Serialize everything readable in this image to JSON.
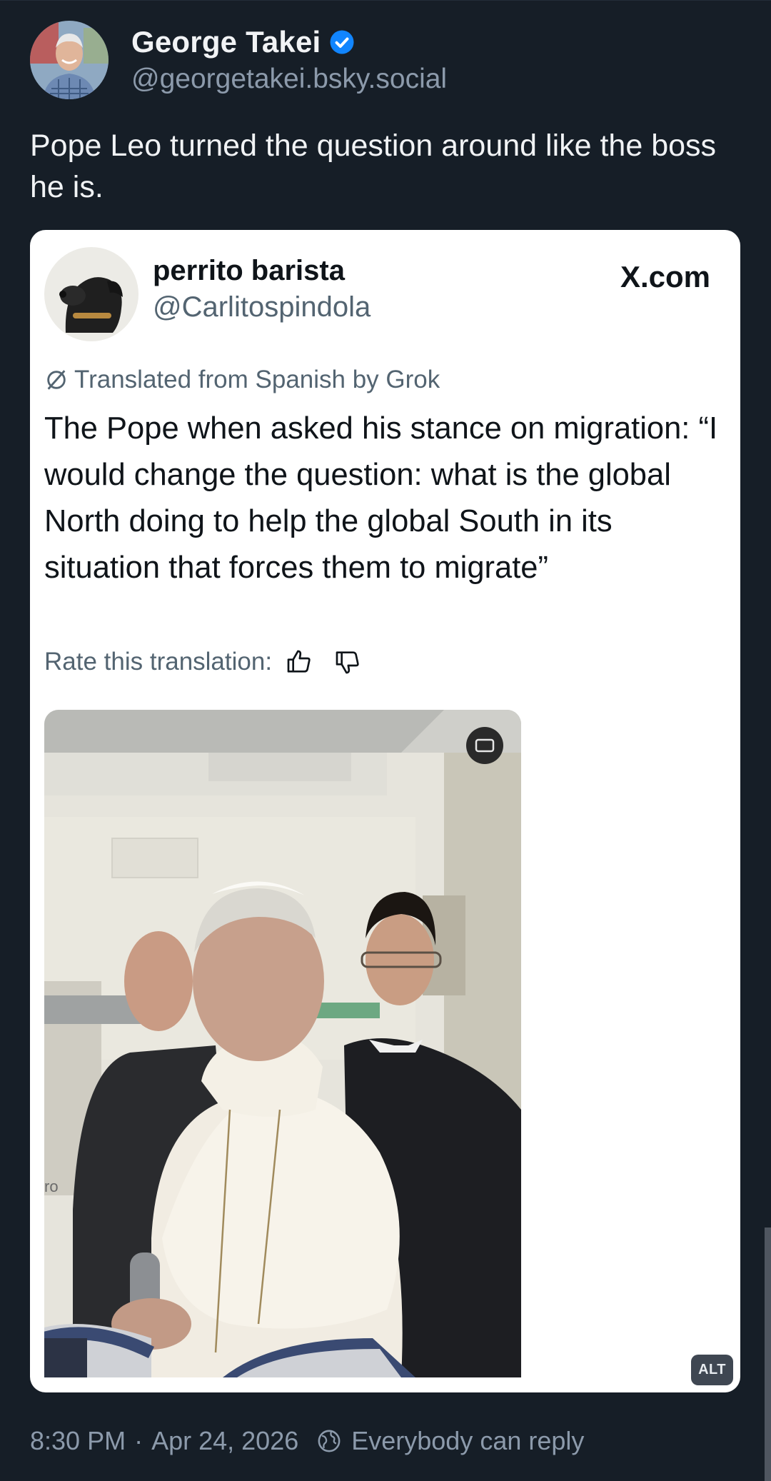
{
  "post": {
    "author": {
      "display_name": "George Takei",
      "handle": "@georgetakei.bsky.social",
      "verified_icon": "verified-check-icon"
    },
    "text": "Pope Leo turned the question around like the boss he is.",
    "footer": {
      "time": "8:30 PM",
      "separator": "·",
      "date": "Apr 24, 2026",
      "reply_setting": "Everybody can reply",
      "reply_icon": "globe-icon"
    }
  },
  "embed": {
    "author": {
      "display_name": "perrito barista",
      "handle": "@Carlitospindola"
    },
    "source": "X.com",
    "translated_note": "Translated from Spanish by Grok",
    "text": "The Pope when asked his stance on migration: “I would change the question: what is the global North doing to help the global South in its situation that forces them to migrate”",
    "rate_label": "Rate this translation:",
    "alt_badge": "ALT"
  },
  "colors": {
    "background": "#161e27",
    "primary_text": "#f1f3f5",
    "secondary_text": "#8c9aab",
    "verified_blue": "#1185fe"
  }
}
